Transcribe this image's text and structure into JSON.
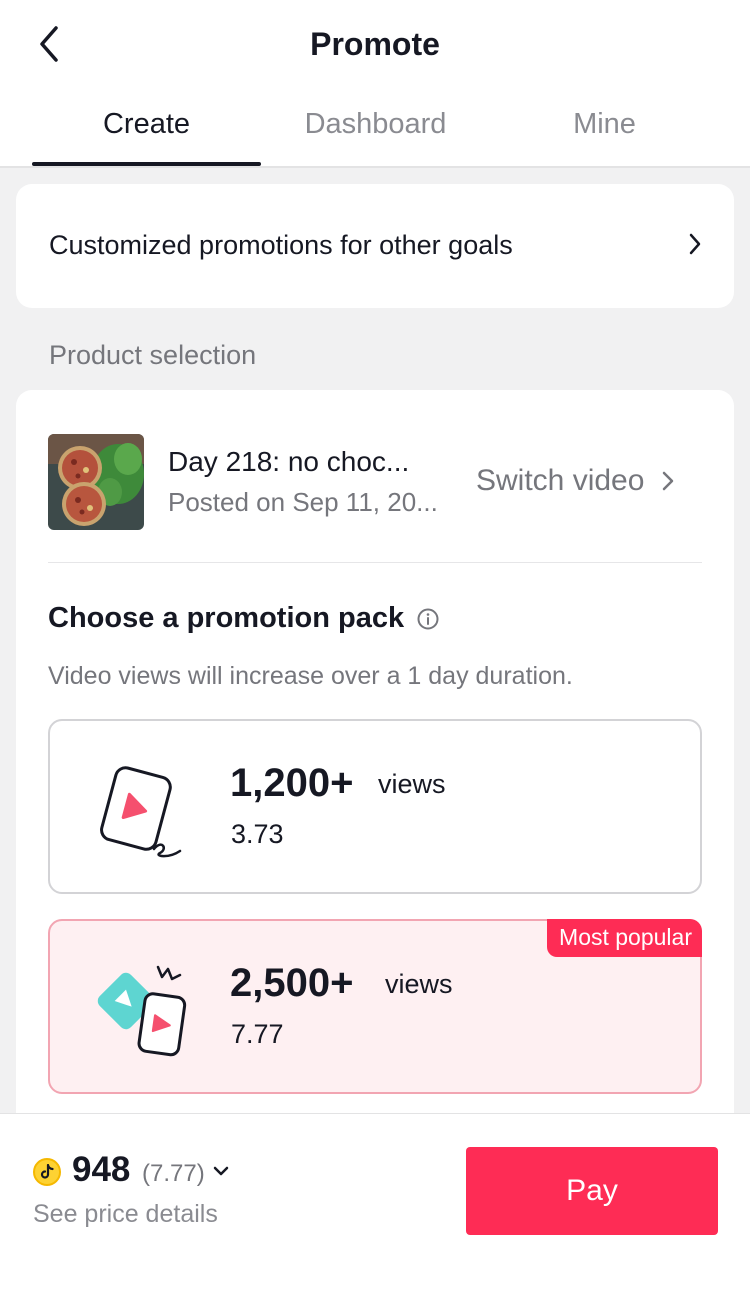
{
  "header": {
    "title": "Promote"
  },
  "tabs": [
    {
      "label": "Create",
      "active": true
    },
    {
      "label": "Dashboard",
      "active": false
    },
    {
      "label": "Mine",
      "active": false
    }
  ],
  "goals": {
    "label": "Customized promotions for other goals"
  },
  "product": {
    "section_label": "Product selection",
    "video_title": "Day 218: no choc...",
    "video_date": "Posted on Sep 11, 20...",
    "switch_label": "Switch video"
  },
  "promotion": {
    "heading": "Choose a promotion pack",
    "description": "Video views will increase over a 1 day duration.",
    "packs": [
      {
        "count": "1,200+",
        "unit": "views",
        "price": "3.73",
        "selected": false
      },
      {
        "count": "2,500+",
        "unit": "views",
        "price": "7.77",
        "badge": "Most popular",
        "selected": true
      }
    ]
  },
  "footer": {
    "coin_amount": "948",
    "coin_sub": "(7.77)",
    "price_details": "See price details",
    "pay_label": "Pay"
  },
  "colors": {
    "accent": "#fe2c55",
    "selected_bg": "#fef0f2",
    "coin": "#fdd233",
    "teal": "#5ed5d1"
  }
}
